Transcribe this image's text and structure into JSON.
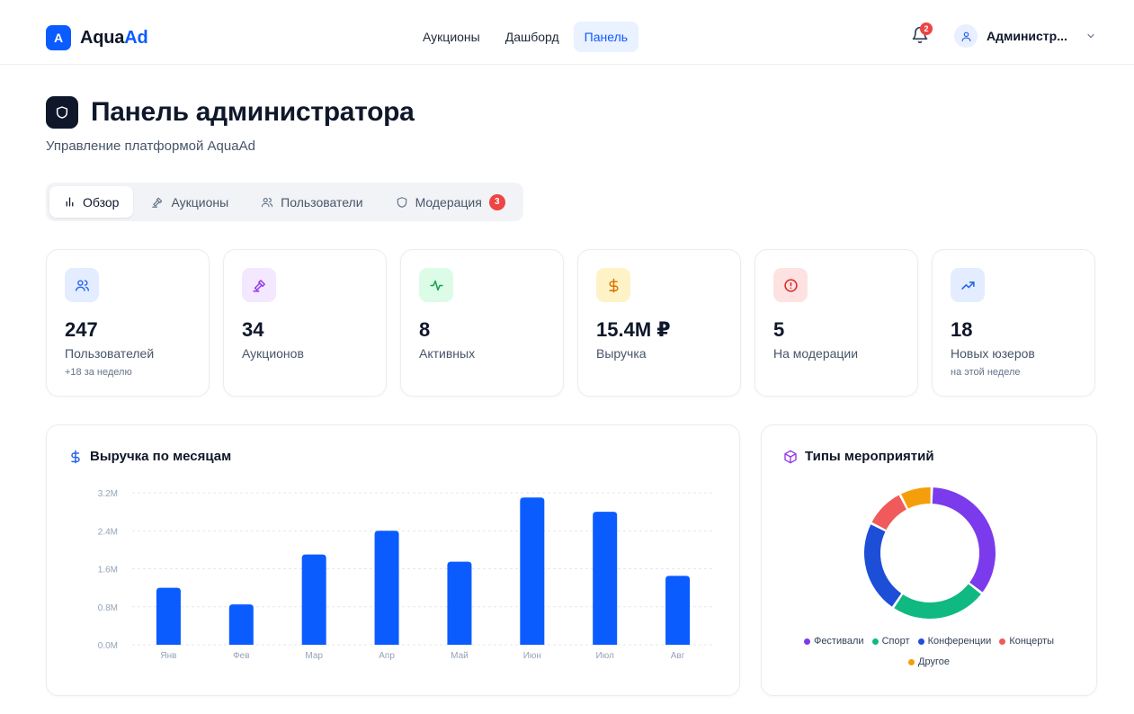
{
  "header": {
    "logo_mark": "A",
    "logo_name": "Aqua",
    "logo_accent": "Ad",
    "nav": [
      {
        "label": "Аукционы",
        "active": false
      },
      {
        "label": "Дашборд",
        "active": false
      },
      {
        "label": "Панель",
        "active": true
      }
    ],
    "notifications_count": "2",
    "user_name": "Администр..."
  },
  "page": {
    "title": "Панель администратора",
    "subtitle": "Управление платформой AquaAd"
  },
  "tabs": [
    {
      "label": "Обзор",
      "icon": "bar-chart-icon",
      "active": true
    },
    {
      "label": "Аукционы",
      "icon": "gavel-icon",
      "active": false
    },
    {
      "label": "Пользователи",
      "icon": "users-icon",
      "active": false
    },
    {
      "label": "Модерация",
      "icon": "shield-icon",
      "active": false,
      "badge": "3"
    }
  ],
  "stats": [
    {
      "value": "247",
      "label": "Пользователей",
      "note": "+18 за неделю",
      "icon": "users-icon",
      "color": "#2563eb",
      "bg": "#e3edff"
    },
    {
      "value": "34",
      "label": "Аукционов",
      "note": "",
      "icon": "gavel-icon",
      "color": "#9333ea",
      "bg": "#f3e8ff"
    },
    {
      "value": "8",
      "label": "Активных",
      "note": "",
      "icon": "activity-icon",
      "color": "#16a34a",
      "bg": "#dcfce7"
    },
    {
      "value": "15.4M ₽",
      "label": "Выручка",
      "note": "",
      "icon": "dollar-icon",
      "color": "#d97706",
      "bg": "#fef3c7"
    },
    {
      "value": "5",
      "label": "На модерации",
      "note": "",
      "icon": "alert-circle-icon",
      "color": "#dc2626",
      "bg": "#fee2e2"
    },
    {
      "value": "18",
      "label": "Новых юзеров",
      "note": "на этой неделе",
      "icon": "trending-up-icon",
      "color": "#2563eb",
      "bg": "#e3edff"
    }
  ],
  "revenue_card": {
    "title": "Выручка по месяцам",
    "icon": "dollar-icon"
  },
  "types_card": {
    "title": "Типы мероприятий",
    "icon": "box-icon"
  },
  "chart_data": [
    {
      "type": "bar",
      "title": "Выручка по месяцам",
      "categories": [
        "Янв",
        "Фев",
        "Мар",
        "Апр",
        "Май",
        "Июн",
        "Июл",
        "Авг"
      ],
      "values": [
        1.2,
        0.85,
        1.9,
        2.4,
        1.75,
        3.1,
        2.8,
        1.45
      ],
      "unit": "M",
      "yticks": [
        "0.0M",
        "0.8M",
        "1.6M",
        "2.4M",
        "3.2M"
      ],
      "ylim": [
        0,
        3.2
      ],
      "color": "#0b5cff",
      "grid": true
    },
    {
      "type": "pie",
      "title": "Типы мероприятий",
      "donut": true,
      "labels": [
        "Фестивали",
        "Спорт",
        "Конференции",
        "Концерты",
        "Другое"
      ],
      "values": [
        35,
        24,
        23,
        10,
        8
      ],
      "colors": [
        "#7c3aed",
        "#10b981",
        "#1d4ed8",
        "#f05a5a",
        "#f59e0b"
      ],
      "legend": "bottom"
    }
  ]
}
